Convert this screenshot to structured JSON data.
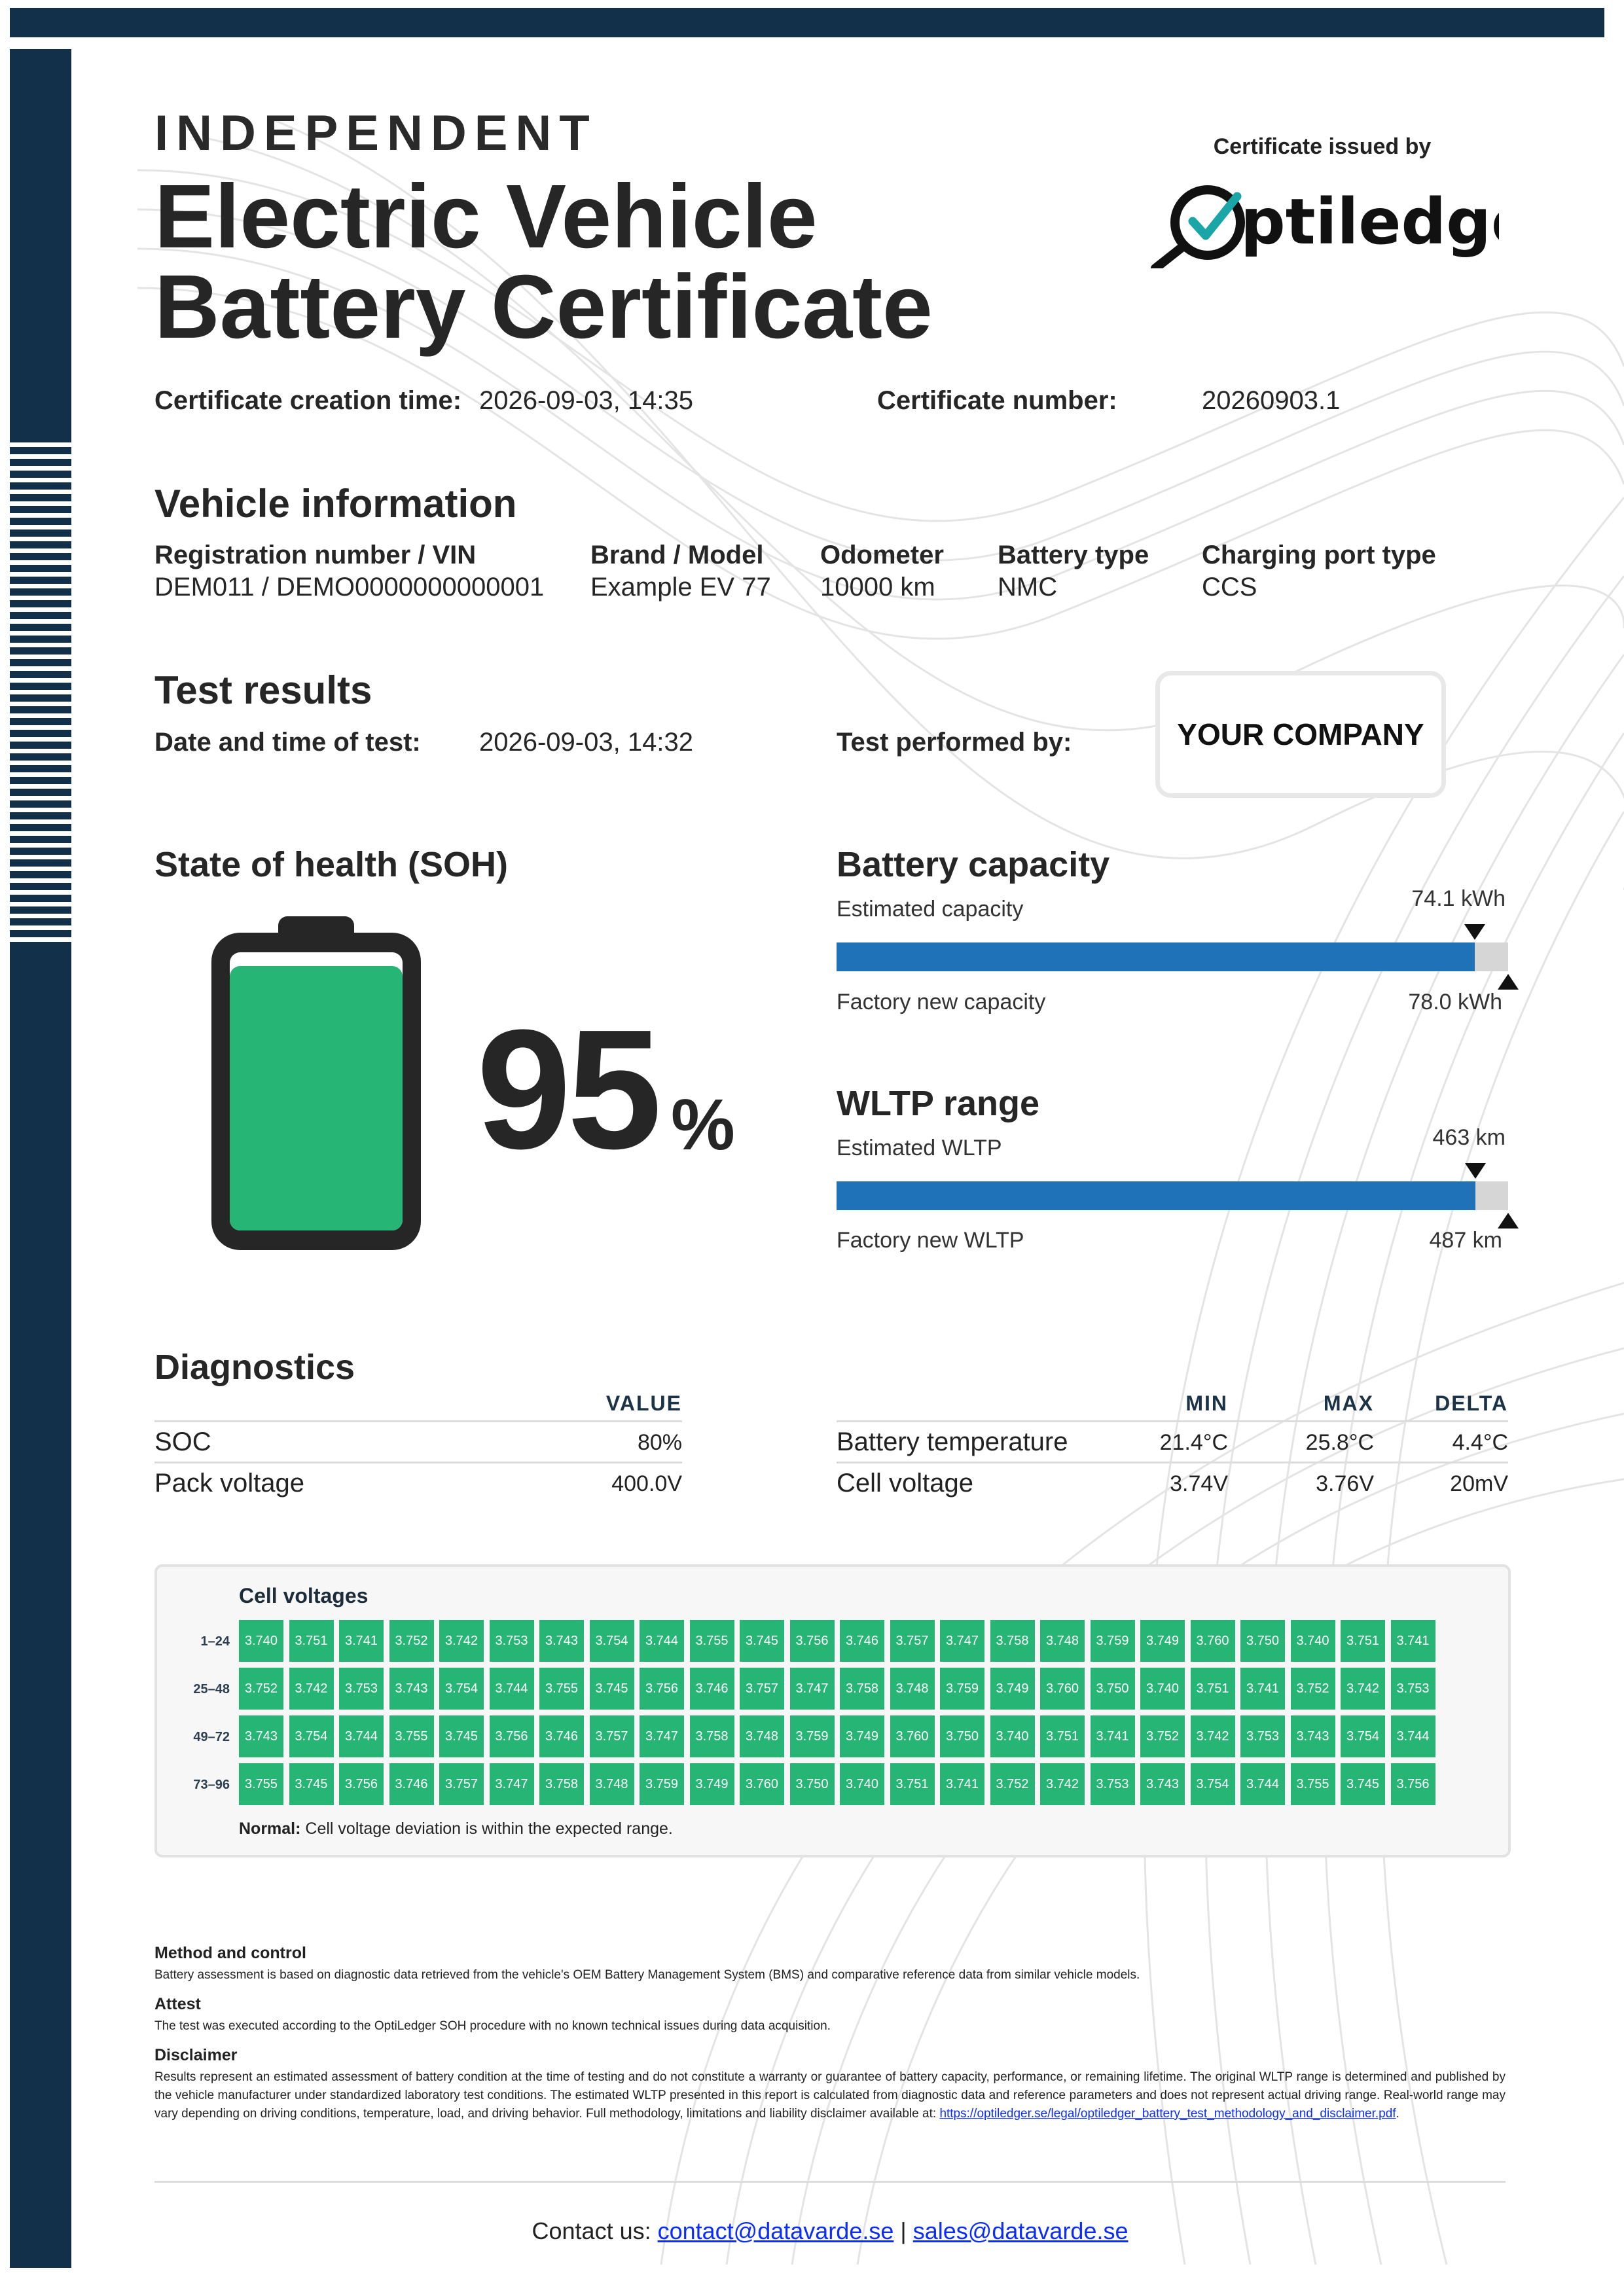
{
  "header": {
    "eyebrow": "INDEPENDENT",
    "title_line1": "Electric Vehicle",
    "title_line2": "Battery Certificate",
    "issued_by": "Certificate issued by",
    "logo_text": "ptiledger",
    "logo_name": "Optiledger"
  },
  "certificate": {
    "creation_time_label": "Certificate creation time:",
    "creation_time": "2026-09-03, 14:35",
    "number_label": "Certificate number:",
    "number": "20260903.1"
  },
  "vehicle": {
    "heading": "Vehicle information",
    "fields": [
      {
        "label": "Registration number / VIN",
        "value": "DEM011 / DEMO0000000000001"
      },
      {
        "label": "Brand / Model",
        "value": "Example EV 77"
      },
      {
        "label": "Odometer",
        "value": "10000 km"
      },
      {
        "label": "Battery type",
        "value": "NMC"
      },
      {
        "label": "Charging port type",
        "value": "CCS"
      }
    ]
  },
  "test": {
    "heading": "Test results",
    "date_label": "Date and time of test:",
    "date": "2026-09-03, 14:32",
    "performed_label": "Test performed by:",
    "company": "YOUR COMPANY"
  },
  "soh": {
    "heading": "State of health (SOH)",
    "value": "95",
    "unit": "%",
    "fill_fraction": 0.95,
    "fill_color": "#27b575"
  },
  "capacity": {
    "heading": "Battery capacity",
    "estimated_label": "Estimated capacity",
    "estimated_value": "74.1 kWh",
    "factory_label": "Factory new capacity",
    "factory_value": "78.0 kWh",
    "fraction": 0.95
  },
  "wltp": {
    "heading": "WLTP range",
    "estimated_label": "Estimated WLTP",
    "estimated_value": "463 km",
    "factory_label": "Factory new WLTP",
    "factory_value": "487 km",
    "fraction": 0.951
  },
  "diagnostics": {
    "heading": "Diagnostics",
    "left": {
      "value_header": "VALUE",
      "rows": [
        {
          "name": "SOC",
          "value": "80%"
        },
        {
          "name": "Pack voltage",
          "value": "400.0V"
        }
      ]
    },
    "right": {
      "min_header": "MIN",
      "max_header": "MAX",
      "delta_header": "DELTA",
      "rows": [
        {
          "name": "Battery temperature",
          "min": "21.4°C",
          "max": "25.8°C",
          "delta": "4.4°C"
        },
        {
          "name": "Cell voltage",
          "min": "3.74V",
          "max": "3.76V",
          "delta": "20mV"
        }
      ]
    }
  },
  "cell_voltages": {
    "title": "Cell voltages",
    "rows": [
      {
        "label": "1–24",
        "values": [
          "3.740",
          "3.751",
          "3.741",
          "3.752",
          "3.742",
          "3.753",
          "3.743",
          "3.754",
          "3.744",
          "3.755",
          "3.745",
          "3.756",
          "3.746",
          "3.757",
          "3.747",
          "3.758",
          "3.748",
          "3.759",
          "3.749",
          "3.760",
          "3.750",
          "3.740",
          "3.751",
          "3.741"
        ]
      },
      {
        "label": "25–48",
        "values": [
          "3.752",
          "3.742",
          "3.753",
          "3.743",
          "3.754",
          "3.744",
          "3.755",
          "3.745",
          "3.756",
          "3.746",
          "3.757",
          "3.747",
          "3.758",
          "3.748",
          "3.759",
          "3.749",
          "3.760",
          "3.750",
          "3.740",
          "3.751",
          "3.741",
          "3.752",
          "3.742",
          "3.753"
        ]
      },
      {
        "label": "49–72",
        "values": [
          "3.743",
          "3.754",
          "3.744",
          "3.755",
          "3.745",
          "3.756",
          "3.746",
          "3.757",
          "3.747",
          "3.758",
          "3.748",
          "3.759",
          "3.749",
          "3.760",
          "3.750",
          "3.740",
          "3.751",
          "3.741",
          "3.752",
          "3.742",
          "3.753",
          "3.743",
          "3.754",
          "3.744"
        ]
      },
      {
        "label": "73–96",
        "values": [
          "3.755",
          "3.745",
          "3.756",
          "3.746",
          "3.757",
          "3.747",
          "3.758",
          "3.748",
          "3.759",
          "3.749",
          "3.760",
          "3.750",
          "3.740",
          "3.751",
          "3.741",
          "3.752",
          "3.742",
          "3.753",
          "3.743",
          "3.754",
          "3.744",
          "3.755",
          "3.745",
          "3.756"
        ]
      }
    ],
    "note_bold": "Normal:",
    "note": "Cell voltage deviation is within the expected range.",
    "cell_color": "#27b575"
  },
  "notes": {
    "method_heading": "Method and control",
    "method_text": "Battery assessment is based on diagnostic data retrieved from the vehicle's OEM Battery Management System (BMS) and comparative reference data from similar vehicle models.",
    "attest_heading": "Attest",
    "attest_text": "The test was executed according to the OptiLedger SOH procedure with no known technical issues during data acquisition.",
    "disclaimer_heading": "Disclaimer",
    "disclaimer_text": "Results represent an estimated assessment of battery condition at the time of testing and do not constitute a warranty or guarantee of battery capacity, performance, or remaining lifetime. The original WLTP range is determined and published by the vehicle manufacturer under standardized laboratory test conditions. The estimated WLTP presented in this report is calculated from diagnostic data and reference parameters and does not represent actual driving range. Real-world range may vary depending on driving conditions, temperature, load, and driving behavior. Full methodology, limitations and liability disclaimer available at:",
    "disclaimer_link": "https://optiledger.se/legal/optiledger_battery_test_methodology_and_disclaimer.pdf",
    "disclaimer_end": "."
  },
  "footer": {
    "contact_label": "Contact us:",
    "email1": "contact@datavarde.se",
    "separator": "|",
    "email2": "sales@datavarde.se"
  },
  "colors": {
    "navy": "#13304a",
    "bar_blue": "#1f72b8",
    "green": "#27b575",
    "logo_teal": "#1aa6a6"
  }
}
